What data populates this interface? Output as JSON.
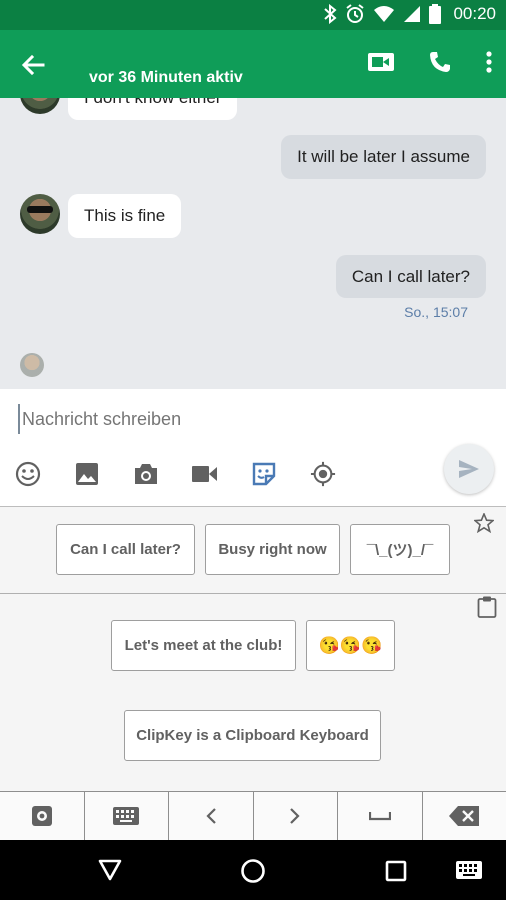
{
  "status_bar": {
    "time": "00:20",
    "icons": [
      "bluetooth-icon",
      "alarm-icon",
      "wifi-icon",
      "signal-icon",
      "battery-icon"
    ],
    "color": "#0b8043"
  },
  "app_bar": {
    "subtitle": "vor 36 Minuten aktiv",
    "color": "#0f9d58",
    "icons": [
      "back-arrow-icon",
      "video-call-icon",
      "phone-icon",
      "more-vert-icon"
    ]
  },
  "messages": [
    {
      "direction": "in",
      "text": "I don't know either"
    },
    {
      "direction": "out",
      "text": "It will be later I assume"
    },
    {
      "direction": "in",
      "text": "This is fine"
    },
    {
      "direction": "out",
      "text": "Can I call later?"
    }
  ],
  "last_timestamp": "So., 15:07",
  "compose": {
    "placeholder": "Nachricht schreiben",
    "tools": [
      "emoji-icon",
      "image-icon",
      "camera-icon",
      "video-icon",
      "sticker-icon",
      "location-icon"
    ],
    "send_icon": "send-icon"
  },
  "keyboard": {
    "favorites": [
      "Can I call later?",
      "Busy right now",
      "¯\\_(ツ)_/¯"
    ],
    "clipboard": [
      "Let's meet at the club!",
      "😘😘😘",
      "ClipKey is a Clipboard Keyboard"
    ],
    "favorites_icon": "star-icon",
    "clipboard_icon": "clipboard-icon",
    "keys": [
      "settings-icon",
      "keyboard-icon",
      "arrow-left-icon",
      "arrow-right-icon",
      "space-icon",
      "backspace-icon"
    ]
  },
  "nav_bar": [
    "back-triangle-icon",
    "home-circle-icon",
    "recents-square-icon",
    "keyboard-switch-icon"
  ]
}
